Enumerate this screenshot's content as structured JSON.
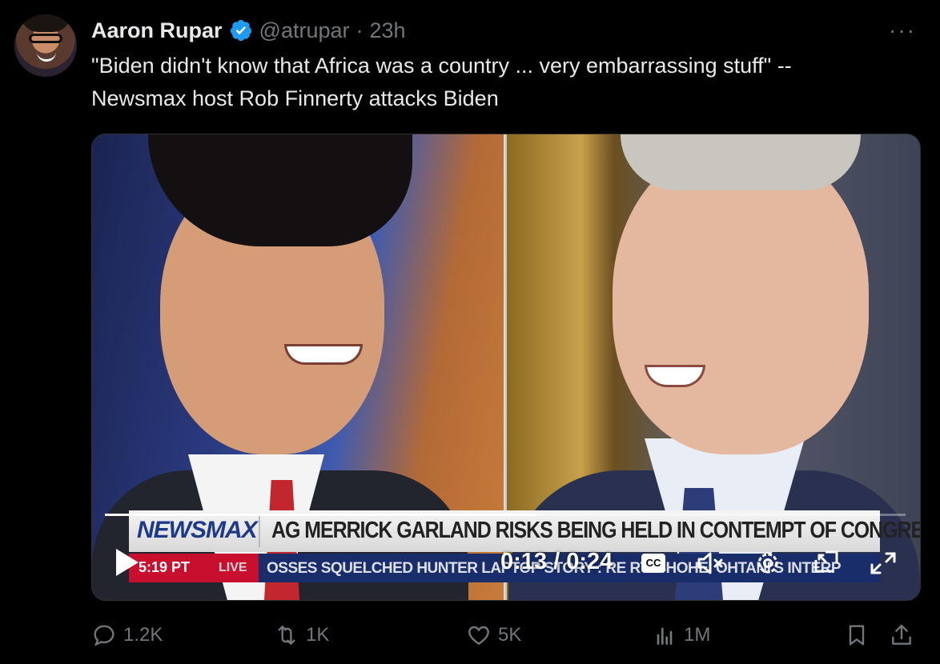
{
  "author": {
    "name": "Aaron Rupar",
    "handle": "@atrupar",
    "separator": "·",
    "time": "23h"
  },
  "more_label": "···",
  "tweet": {
    "line1": "\"Biden didn't know that Africa was a country ... very embarrassing stuff\" --",
    "line2": "Newsmax host Rob Finnerty attacks Biden"
  },
  "video": {
    "channel_logo": "NEWSMAX",
    "headline": "AG MERRICK GARLAND RISKS BEING HELD IN CONTEMPT OF CONGRESS",
    "clock": "5:19 PT",
    "live": "LIVE",
    "ticker": "OSSES SQUELCHED HUNTER LAPTOP STORY : RE  RT: SHOHEI OHTANI'S INTERP",
    "current_time": "0:13 / 0:24",
    "progress_fraction": 0.54,
    "cc_label": "CC",
    "icons": [
      "play-icon",
      "closed-captions-icon",
      "mute-icon",
      "settings-icon",
      "picture-in-picture-icon",
      "fullscreen-icon"
    ]
  },
  "actions": {
    "replies": "1.2K",
    "reposts": "1K",
    "likes": "5K",
    "views": "1M"
  },
  "colors": {
    "background": "#000000",
    "text": "#e7e9ea",
    "muted": "#71767b",
    "verified": "#1d9bf0",
    "newsmax_red": "#c8102e",
    "newsmax_blue": "#1a2d6b"
  }
}
